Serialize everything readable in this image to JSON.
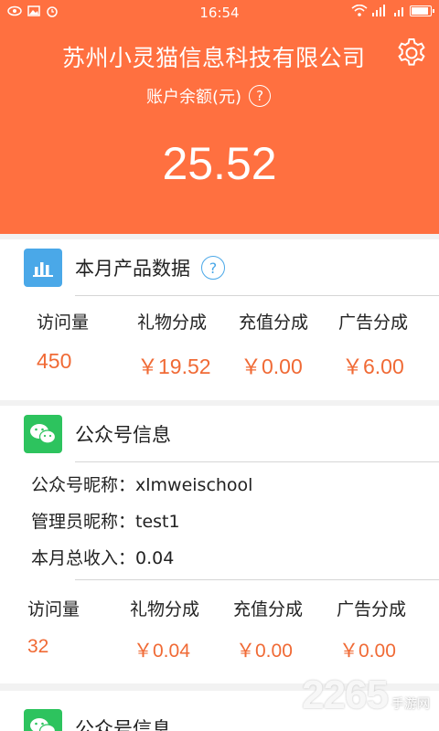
{
  "status_bar": {
    "time": "16:54"
  },
  "header": {
    "company_name": "苏州小灵猫信息科技有限公司",
    "balance_label": "账户余额(元)",
    "help_symbol": "?",
    "balance": "25.52"
  },
  "monthly": {
    "title": "本月产品数据",
    "help_symbol": "?",
    "labels": [
      "访问量",
      "礼物分成",
      "充值分成",
      "广告分成"
    ],
    "values": [
      "450",
      "￥19.52",
      "￥0.00",
      "￥6.00"
    ]
  },
  "accounts": [
    {
      "title": "公众号信息",
      "nickname_line": "公众号昵称：xlmweischool",
      "admin_line": "管理员昵称：test1",
      "income_line": "本月总收入：0.04",
      "labels": [
        "访问量",
        "礼物分成",
        "充值分成",
        "广告分成"
      ],
      "values": [
        "32",
        "￥0.04",
        "￥0.00",
        "￥0.00"
      ]
    },
    {
      "title": "公众号信息"
    }
  ],
  "watermark": {
    "number": "2265",
    "suffix": "手游网"
  },
  "icons": {
    "balance_help": "question-icon",
    "settings": "gear-icon",
    "monthly": "bar-chart-icon",
    "wechat": "wechat-icon"
  },
  "colors": {
    "header": "#ff7040",
    "accent": "#f06a35",
    "monthly_icon": "#4aa8e8",
    "wechat_icon": "#2dc35e"
  },
  "battery_level": 0.9
}
